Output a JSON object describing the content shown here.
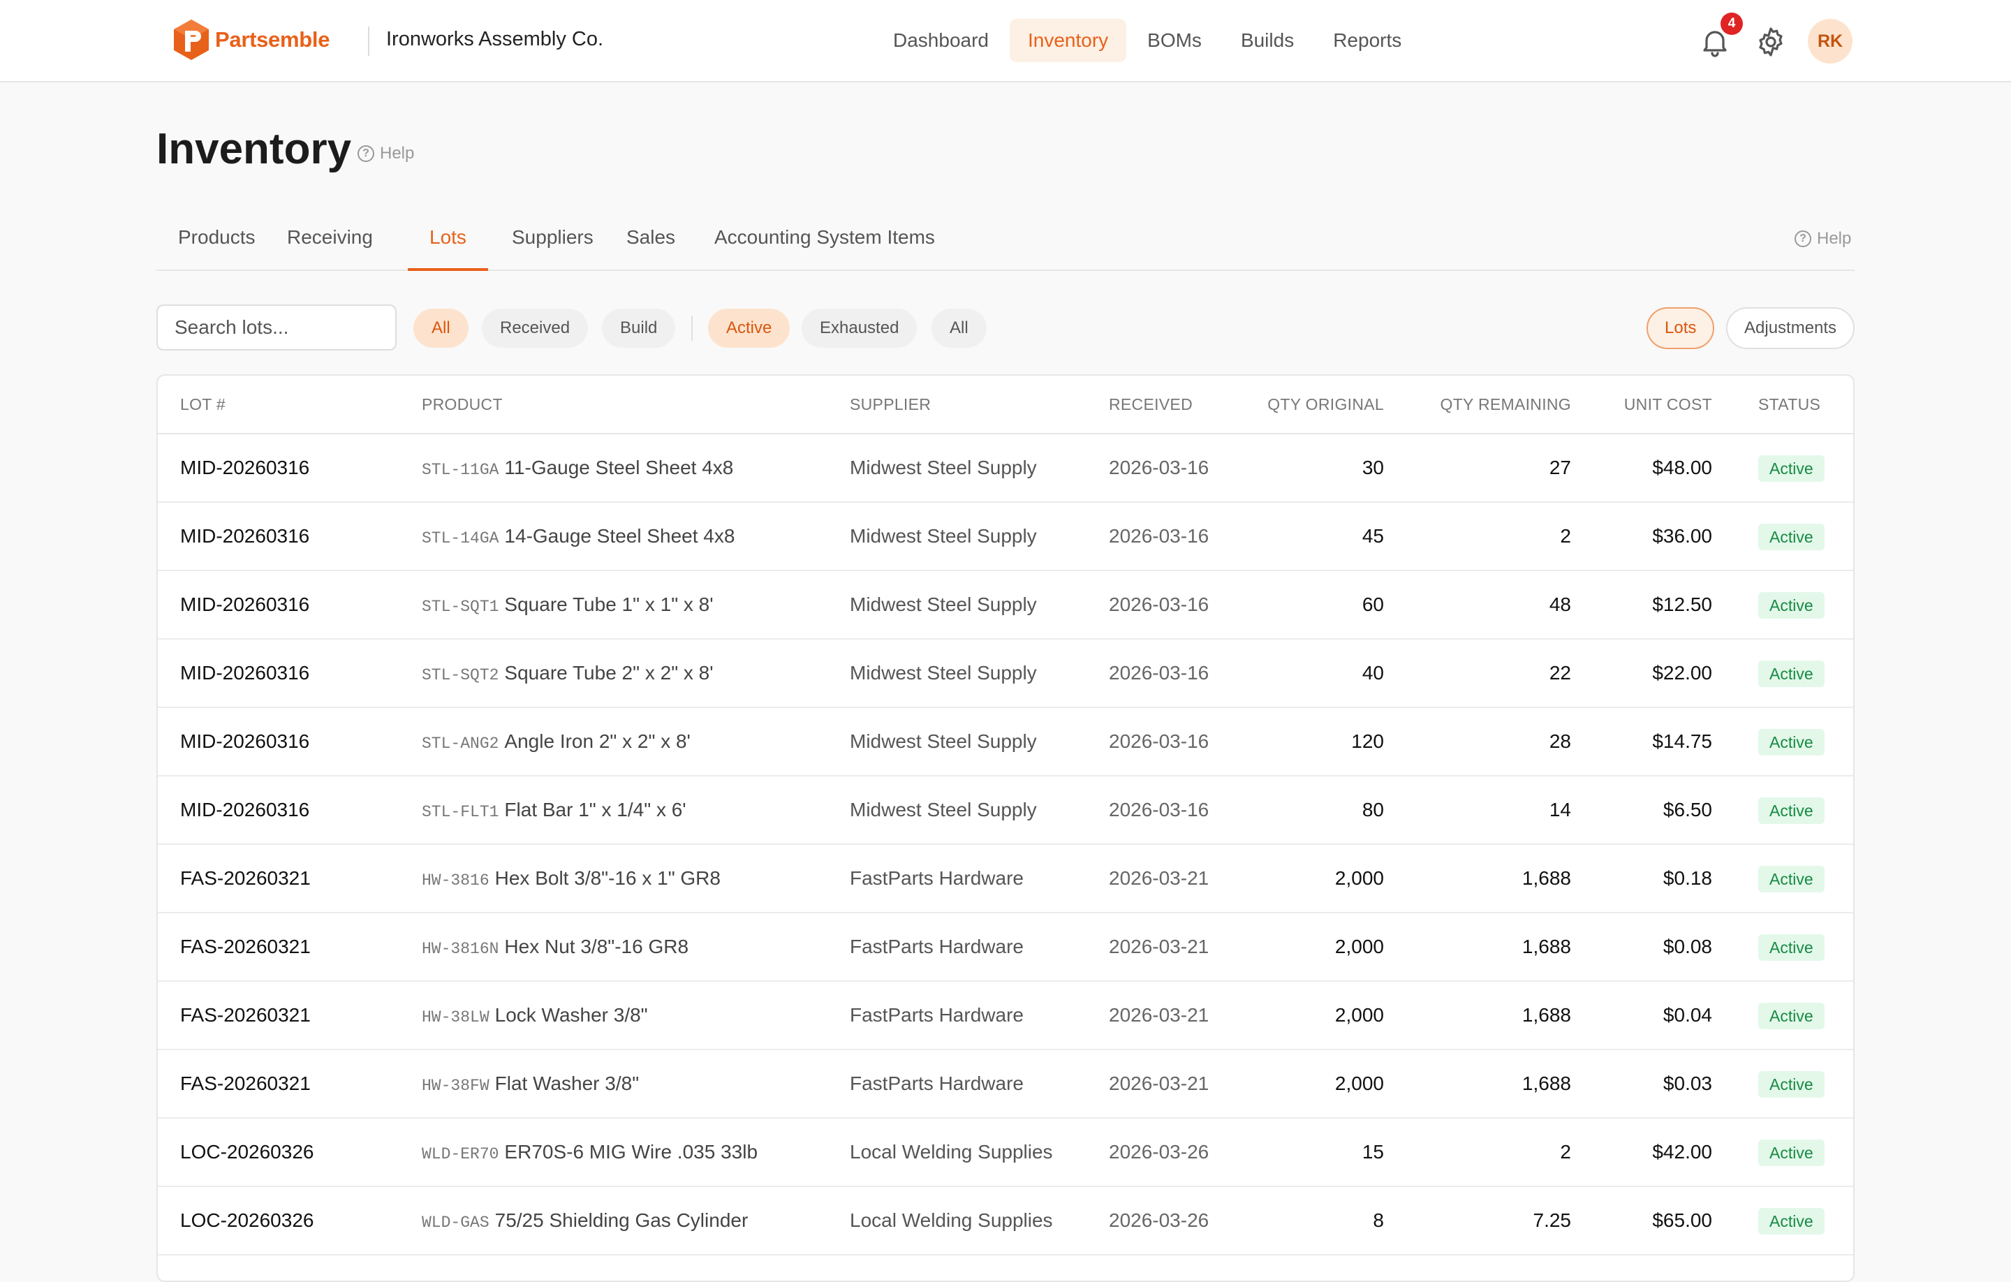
{
  "brand": {
    "name": "Partsemble",
    "org": "Ironworks Assembly Co.",
    "accent": "#e8611a"
  },
  "nav": [
    {
      "label": "Dashboard",
      "active": false
    },
    {
      "label": "Inventory",
      "active": true
    },
    {
      "label": "BOMs",
      "active": false
    },
    {
      "label": "Builds",
      "active": false
    },
    {
      "label": "Reports",
      "active": false
    }
  ],
  "header_icons": {
    "notifications_count": "4",
    "avatar_initials": "RK"
  },
  "page": {
    "title": "Inventory",
    "help": "Help"
  },
  "tabs": [
    {
      "label": "Products",
      "active": false
    },
    {
      "label": "Receiving",
      "active": false
    },
    {
      "label": "Lots",
      "active": true
    },
    {
      "label": "Suppliers",
      "active": false
    },
    {
      "label": "Sales",
      "active": false
    },
    {
      "label": "Accounting System Items",
      "active": false
    }
  ],
  "tabs_help": "Help",
  "filters": {
    "search_placeholder": "Search lots...",
    "source": [
      {
        "label": "All",
        "active": true
      },
      {
        "label": "Received",
        "active": false
      },
      {
        "label": "Build",
        "active": false
      }
    ],
    "state": [
      {
        "label": "Active",
        "active": true
      },
      {
        "label": "Exhausted",
        "active": false
      },
      {
        "label": "All",
        "active": false
      }
    ],
    "view": [
      {
        "label": "Lots",
        "active": true
      },
      {
        "label": "Adjustments",
        "active": false
      }
    ]
  },
  "table": {
    "columns": [
      "LOT #",
      "PRODUCT",
      "SUPPLIER",
      "RECEIVED",
      "QTY ORIGINAL",
      "QTY REMAINING",
      "UNIT COST",
      "STATUS"
    ],
    "rows": [
      {
        "lot": "MID-20260316",
        "sku": "STL-11GA",
        "product": "11-Gauge Steel Sheet 4x8",
        "supplier": "Midwest Steel Supply",
        "received": "2026-03-16",
        "qty_original": "30",
        "qty_remaining": "27",
        "unit_cost": "$48.00",
        "status": "Active"
      },
      {
        "lot": "MID-20260316",
        "sku": "STL-14GA",
        "product": "14-Gauge Steel Sheet 4x8",
        "supplier": "Midwest Steel Supply",
        "received": "2026-03-16",
        "qty_original": "45",
        "qty_remaining": "2",
        "unit_cost": "$36.00",
        "status": "Active"
      },
      {
        "lot": "MID-20260316",
        "sku": "STL-SQT1",
        "product": "Square Tube 1\" x 1\" x 8'",
        "supplier": "Midwest Steel Supply",
        "received": "2026-03-16",
        "qty_original": "60",
        "qty_remaining": "48",
        "unit_cost": "$12.50",
        "status": "Active"
      },
      {
        "lot": "MID-20260316",
        "sku": "STL-SQT2",
        "product": "Square Tube 2\" x 2\" x 8'",
        "supplier": "Midwest Steel Supply",
        "received": "2026-03-16",
        "qty_original": "40",
        "qty_remaining": "22",
        "unit_cost": "$22.00",
        "status": "Active"
      },
      {
        "lot": "MID-20260316",
        "sku": "STL-ANG2",
        "product": "Angle Iron 2\" x 2\" x 8'",
        "supplier": "Midwest Steel Supply",
        "received": "2026-03-16",
        "qty_original": "120",
        "qty_remaining": "28",
        "unit_cost": "$14.75",
        "status": "Active"
      },
      {
        "lot": "MID-20260316",
        "sku": "STL-FLT1",
        "product": "Flat Bar 1\" x 1/4\" x 6'",
        "supplier": "Midwest Steel Supply",
        "received": "2026-03-16",
        "qty_original": "80",
        "qty_remaining": "14",
        "unit_cost": "$6.50",
        "status": "Active"
      },
      {
        "lot": "FAS-20260321",
        "sku": "HW-3816",
        "product": "Hex Bolt 3/8\"-16 x 1\" GR8",
        "supplier": "FastParts Hardware",
        "received": "2026-03-21",
        "qty_original": "2,000",
        "qty_remaining": "1,688",
        "unit_cost": "$0.18",
        "status": "Active"
      },
      {
        "lot": "FAS-20260321",
        "sku": "HW-3816N",
        "product": "Hex Nut 3/8\"-16 GR8",
        "supplier": "FastParts Hardware",
        "received": "2026-03-21",
        "qty_original": "2,000",
        "qty_remaining": "1,688",
        "unit_cost": "$0.08",
        "status": "Active"
      },
      {
        "lot": "FAS-20260321",
        "sku": "HW-38LW",
        "product": "Lock Washer 3/8\"",
        "supplier": "FastParts Hardware",
        "received": "2026-03-21",
        "qty_original": "2,000",
        "qty_remaining": "1,688",
        "unit_cost": "$0.04",
        "status": "Active"
      },
      {
        "lot": "FAS-20260321",
        "sku": "HW-38FW",
        "product": "Flat Washer 3/8\"",
        "supplier": "FastParts Hardware",
        "received": "2026-03-21",
        "qty_original": "2,000",
        "qty_remaining": "1,688",
        "unit_cost": "$0.03",
        "status": "Active"
      },
      {
        "lot": "LOC-20260326",
        "sku": "WLD-ER70",
        "product": "ER70S-6 MIG Wire .035 33lb",
        "supplier": "Local Welding Supplies",
        "received": "2026-03-26",
        "qty_original": "15",
        "qty_remaining": "2",
        "unit_cost": "$42.00",
        "status": "Active"
      },
      {
        "lot": "LOC-20260326",
        "sku": "WLD-GAS",
        "product": "75/25 Shielding Gas Cylinder",
        "supplier": "Local Welding Supplies",
        "received": "2026-03-26",
        "qty_original": "8",
        "qty_remaining": "7.25",
        "unit_cost": "$65.00",
        "status": "Active"
      },
      {
        "lot": "",
        "sku": "",
        "product": "",
        "supplier": "",
        "received": "",
        "qty_original": "",
        "qty_remaining": "",
        "unit_cost": "",
        "status": ""
      }
    ]
  }
}
